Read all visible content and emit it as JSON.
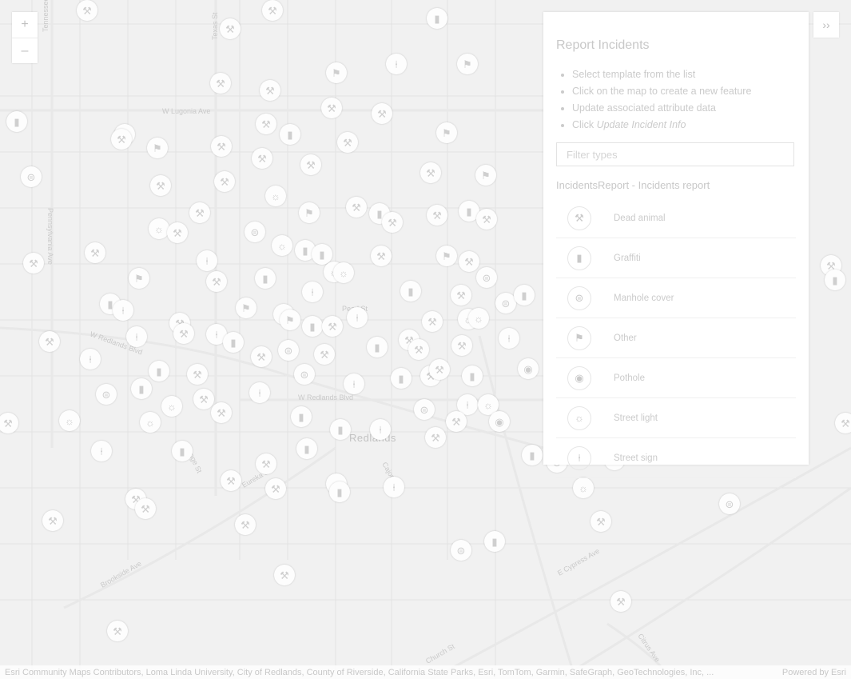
{
  "map": {
    "road_labels": [
      "W Lugonia Ave",
      "Pearl St",
      "W Redlands Blvd",
      "Redlands",
      "E Cypress Ave",
      "Brookside Ave",
      "Tennessee St",
      "Texas St",
      "Church St",
      "Citrus Ave",
      "Cajon St",
      "Orange St",
      "W Redlands Blvd",
      "Eureka St",
      "Pennsylvania Ave"
    ],
    "city_label": "Redlands",
    "feature_icons": {
      "dead_animal": "hammer-icon",
      "graffiti": "spray-can-icon",
      "manhole_cover": "manhole-icon",
      "other": "flag-icon",
      "pothole": "pothole-icon",
      "street_light": "street-light-icon",
      "street_sign": "street-sign-icon"
    }
  },
  "zoom": {
    "in_label": "+",
    "out_label": "–"
  },
  "panel": {
    "collapse_label": "››",
    "title": "Report Incidents",
    "steps": [
      "Select template from the list",
      "Click on the map to create a new feature",
      "Update associated attribute data",
      "Click"
    ],
    "step4_emphasis": "Update Incident Info",
    "filter_placeholder": "Filter types",
    "group_title": "IncidentsReport - Incidents report",
    "types": [
      {
        "label": "Dead animal",
        "icon": "hammer-icon"
      },
      {
        "label": "Graffiti",
        "icon": "spray-can-icon"
      },
      {
        "label": "Manhole cover",
        "icon": "manhole-icon"
      },
      {
        "label": "Other",
        "icon": "flag-icon"
      },
      {
        "label": "Pothole",
        "icon": "pothole-icon"
      },
      {
        "label": "Street light",
        "icon": "street-light-icon"
      },
      {
        "label": "Street sign",
        "icon": "street-sign-icon"
      }
    ]
  },
  "attribution": {
    "text": "Esri Community Maps Contributors, Loma Linda University, City of Redlands, County of Riverside, California State Parks, Esri, TomTom, Garmin, SafeGraph, GeoTechnologies, Inc, ...",
    "powered": "Powered by Esri"
  }
}
